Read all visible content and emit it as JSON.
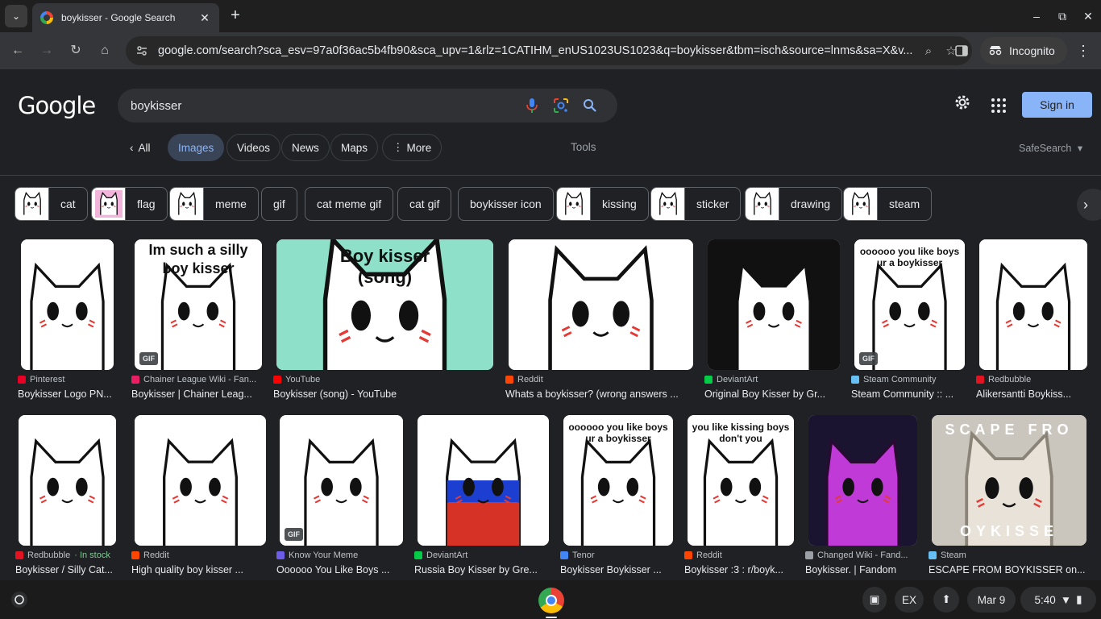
{
  "browser": {
    "tab_title": "boykisser - Google Search",
    "url": "google.com/search?sca_esv=97a0f36ac5b4fb90&sca_upv=1&rlz=1CATIHM_enUS1023US1023&q=boykisser&tbm=isch&source=lnms&sa=X&v...",
    "incognito_label": "Incognito"
  },
  "search": {
    "logo": "Google",
    "query": "boykisser",
    "sign_in": "Sign in",
    "tabs": [
      "All",
      "Images",
      "Videos",
      "News",
      "Maps",
      "More"
    ],
    "tools": "Tools",
    "safesearch": "SafeSearch"
  },
  "chips": [
    "cat",
    "flag",
    "meme",
    "gif",
    "cat meme gif",
    "cat gif",
    "boykisser icon",
    "kissing",
    "sticker",
    "drawing",
    "steam"
  ],
  "results_row1": [
    {
      "source": "Pinterest",
      "title": "Boykisser Logo PN...",
      "fav": "#e60023"
    },
    {
      "source": "Chainer League Wiki - Fan...",
      "title": "Boykisser | Chainer Leag...",
      "fav": "#e91e63",
      "badge": "GIF"
    },
    {
      "source": "YouTube",
      "title": "Boykisser (song) - YouTube",
      "fav": "#ff0000",
      "caption": "Boy kisser",
      "caption2": "(song)"
    },
    {
      "source": "Reddit",
      "title": "Whats a boykisser? (wrong answers ...",
      "fav": "#ff4500"
    },
    {
      "source": "DeviantArt",
      "title": "Original Boy Kisser by Gr...",
      "fav": "#05cc47"
    },
    {
      "source": "Steam Community",
      "title": "Steam Community :: ...",
      "fav": "#66c0f4",
      "badge": "GIF",
      "caption": "oooooo you like boys",
      "caption2": "ur a boykisser"
    },
    {
      "source": "Redbubble",
      "title": "Alikersantti Boykiss...",
      "fav": "#e41321"
    }
  ],
  "results_row2": [
    {
      "source": "Redbubble",
      "stock": "· In stock",
      "title": "Boykisser / Silly Cat...",
      "fav": "#e41321"
    },
    {
      "source": "Reddit",
      "title": "High quality boy kisser ...",
      "fav": "#ff4500"
    },
    {
      "source": "Know Your Meme",
      "title": "Oooooo You Like Boys ...",
      "fav": "#6c5ce7",
      "badge": "GIF"
    },
    {
      "source": "DeviantArt",
      "title": "Russia Boy Kisser by Gre...",
      "fav": "#05cc47"
    },
    {
      "source": "Tenor",
      "title": "Boykisser Boykisser ...",
      "fav": "#4285f4",
      "caption": "oooooo you like boys",
      "caption2": "ur a boykisser"
    },
    {
      "source": "Reddit",
      "title": "Boykisser :3 : r/boyk...",
      "fav": "#ff4500",
      "caption": "you like kissing boys",
      "caption2": "don't you"
    },
    {
      "source": "Changed Wiki - Fand...",
      "title": "Boykisser. | Fandom",
      "fav": "#9aa0a6"
    },
    {
      "source": "Steam",
      "title": "ESCAPE FROM BOYKISSER on...",
      "fav": "#66c0f4",
      "caption": "SCAPE FRO",
      "caption2": "OYKISSE"
    }
  ],
  "image1_caption": {
    "line1": "Im such a silly",
    "line2": "boy kisser"
  },
  "shelf": {
    "ex": "EX",
    "date": "Mar 9",
    "time": "5:40"
  },
  "colors": {
    "accent": "#8ab4f8",
    "bg": "#202124"
  }
}
